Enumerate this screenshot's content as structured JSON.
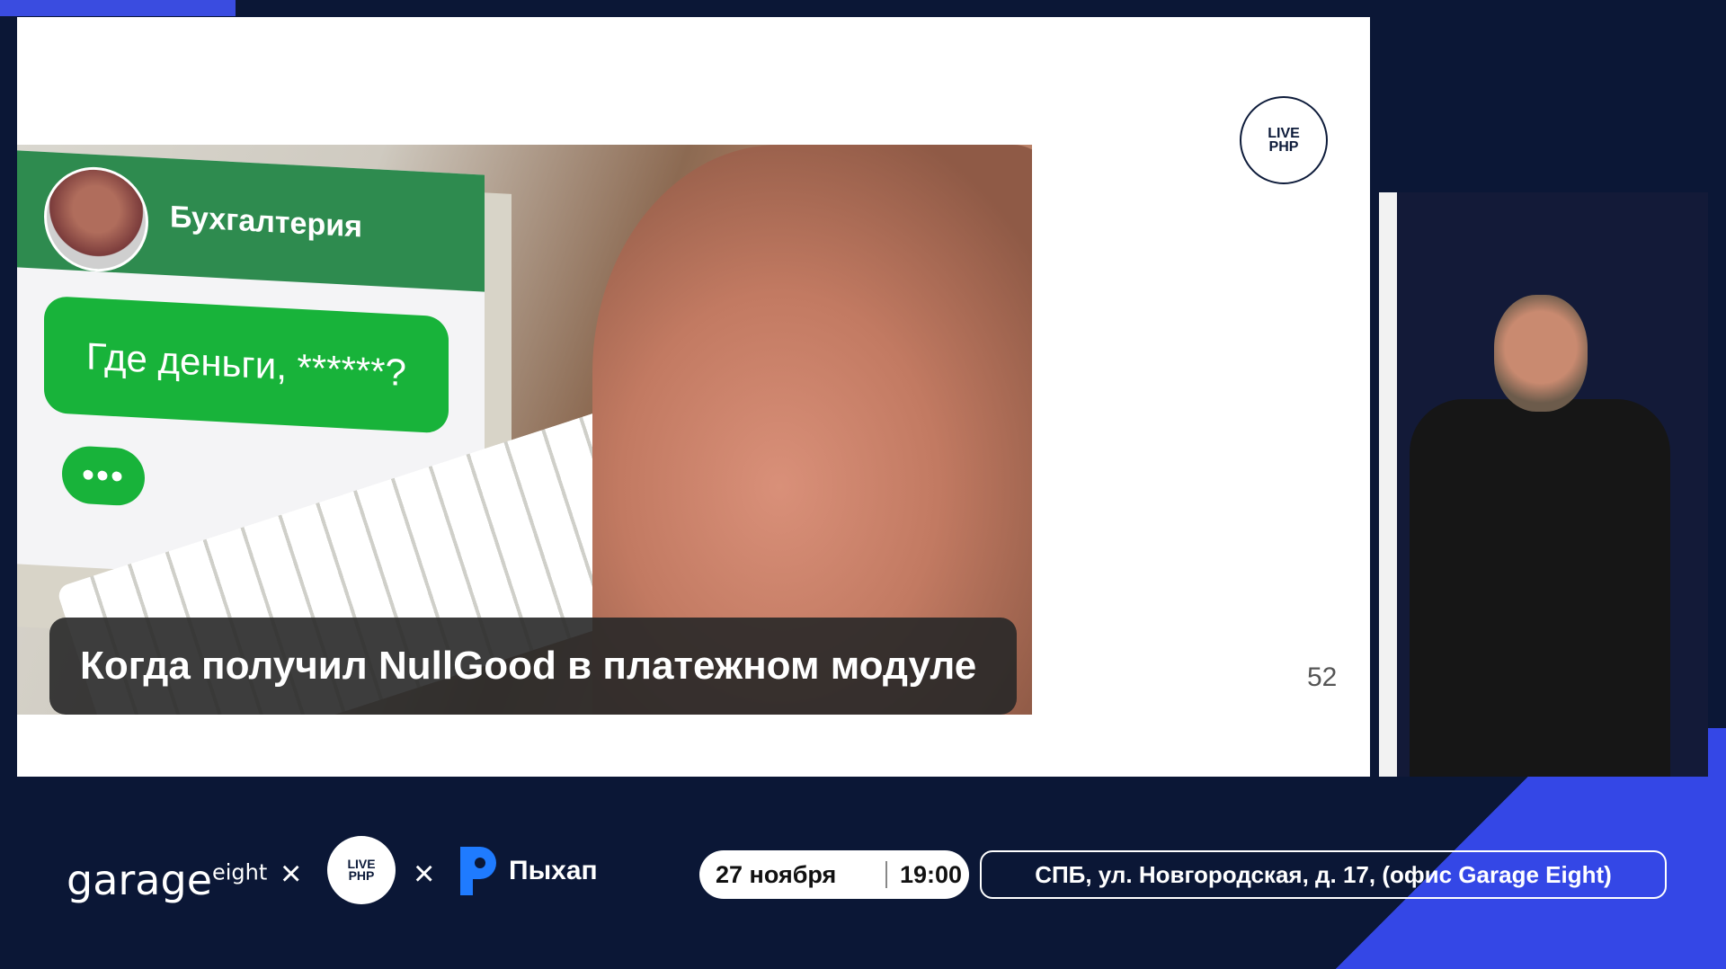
{
  "slide": {
    "logo_text_line1": "LIVE",
    "logo_text_line2": "PHP",
    "page_number": "52",
    "meme": {
      "chat_title": "Бухгалтерия",
      "message": "Где деньги, ******?",
      "typing_indicator": "•••",
      "caption": "Когда получил NullGood в платежном модуле"
    }
  },
  "bottom_bar": {
    "garage_logo": "garage",
    "garage_sup": "eight",
    "times_symbol": "×",
    "live_php_line1": "LIVE",
    "live_php_line2": "PHP",
    "pykhap_label": "Пыхап",
    "date": "27 ноября",
    "time": "19:00",
    "address": "СПБ, ул. Новгородская, д. 17, (офис Garage Eight)"
  },
  "colors": {
    "background": "#0b1736",
    "accent_blue": "#3447e6",
    "chat_header_green": "#2e8b4f",
    "bubble_green": "#18b33a"
  }
}
